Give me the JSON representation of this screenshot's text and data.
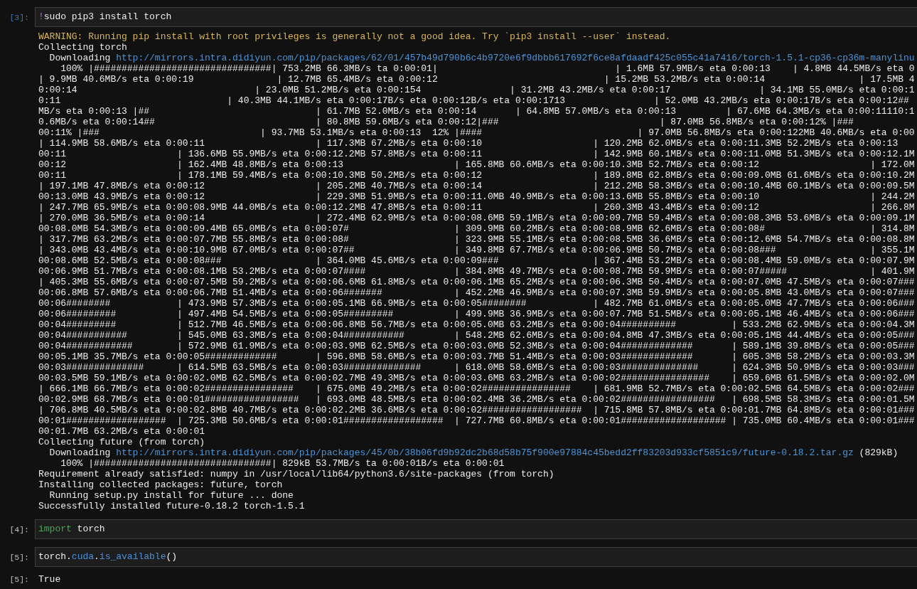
{
  "cells": [
    {
      "prompt": "[3]:",
      "selected": true,
      "source": [
        {
          "kind": "magic",
          "text": "!"
        },
        {
          "kind": "name",
          "text": "sudo pip3 install torch"
        }
      ],
      "output": {
        "kind": "stream",
        "lines": [
          {
            "kind": "warning",
            "text": "WARNING: Running pip install with root privileges is generally not a good idea. Try `pip3 install --user` instead."
          },
          {
            "kind": "text",
            "text": "Collecting torch"
          },
          {
            "kind": "download",
            "label": "  Downloading",
            "url": "http://mirrors.intra.didiyun.com/pip/packages/62/01/457b49d790b6c4b9720e6f9dbbb617692f6ce8afdaadf425c055c41a7416/torch-1.5.1-cp36-cp36m-manylinu"
          },
          {
            "kind": "text",
            "text": "    100% |################################| 753.2MB 66.3MB/s ta 0:00:01|                                | 1.6MB 57.9MB/s eta 0:00:13    | 4.8MB 44.5MB/s eta 0"
          },
          {
            "kind": "text",
            "text": "| 9.9MB 40.6MB/s eta 0:00:19               | 12.7MB 65.4MB/s eta 0:00:12                              | 15.2MB 53.2MB/s eta 0:00:14                 | 17.5MB 4"
          },
          {
            "kind": "text",
            "text": "0:00:14                                | 23.0MB 51.2MB/s eta 0:00:154                | 31.2MB 43.2MB/s eta 0:00:17                | 34.1MB 55.0MB/s eta 0:00:1"
          },
          {
            "kind": "text",
            "text": "0:11                              | 40.3MB 44.1MB/s eta 0:00:17B/s eta 0:00:12B/s eta 0:00:1713                | 52.0MB 43.2MB/s eta 0:00:17B/s eta 0:00:12##"
          },
          {
            "kind": "text",
            "text": "MB/s eta 0:00:13 |##                              | 61.7MB 52.0MB/s eta 0:00:14       | 64.8MB 57.0MB/s eta 0:00:13         | 67.6MB 64.3MB/s eta 0:00:11110:1"
          },
          {
            "kind": "text",
            "text": "0.6MB/s eta 0:00:14##                             | 80.8MB 59.6MB/s eta 0:00:12|###                             | 87.0MB 56.8MB/s eta 0:00:12% |###"
          },
          {
            "kind": "text",
            "text": "00:11% |###                             | 93.7MB 53.1MB/s eta 0:00:13  12% |####                            | 97.0MB 56.8MB/s eta 0:00:122MB 40.6MB/s eta 0:00"
          },
          {
            "kind": "text",
            "text": "| 114.9MB 58.6MB/s eta 0:00:11                    | 117.3MB 67.2MB/s eta 0:00:10                    | 120.2MB 62.0MB/s eta 0:00:11.3MB 52.2MB/s eta 0:00:13"
          },
          {
            "kind": "text",
            "text": "00:11                    | 136.6MB 55.9MB/s eta 0:00:12.2MB 57.8MB/s eta 0:00:11                    | 142.9MB 60.1MB/s eta 0:00:11.0MB 51.3MB/s eta 0:00:12.1M"
          },
          {
            "kind": "text",
            "text": "00:12                    | 162.4MB 48.8MB/s eta 0:00:13                    | 165.8MB 60.6MB/s eta 0:00:10.3MB 52.7MB/s eta 0:00:12                    | 172.0M"
          },
          {
            "kind": "text",
            "text": "00:11                    | 178.1MB 59.4MB/s eta 0:00:10.3MB 50.2MB/s eta 0:00:12                    | 189.8MB 62.8MB/s eta 0:00:09.0MB 61.6MB/s eta 0:00:10.2M"
          },
          {
            "kind": "text",
            "text": "| 197.1MB 47.8MB/s eta 0:00:12                    | 205.2MB 40.7MB/s eta 0:00:14                    | 212.2MB 58.3MB/s eta 0:00:10.4MB 60.1MB/s eta 0:00:09.5M"
          },
          {
            "kind": "text",
            "text": "00:13.0MB 43.9MB/s eta 0:00:12                    | 229.3MB 51.9MB/s eta 0:00:11.0MB 40.9MB/s eta 0:00:13.6MB 55.8MB/s eta 0:00:10                    | 244.2M"
          },
          {
            "kind": "text",
            "text": "| 247.7MB 65.9MB/s eta 0:00:08.9MB 44.0MB/s eta 0:00:12.2MB 47.8MB/s eta 0:00:11                    | 260.3MB 43.4MB/s eta 0:00:12                    | 266.8M"
          },
          {
            "kind": "text",
            "text": "| 270.0MB 36.5MB/s eta 0:00:14                    | 272.4MB 62.9MB/s eta 0:00:08.6MB 59.1MB/s eta 0:00:09.7MB 59.4MB/s eta 0:00:08.3MB 53.6MB/s eta 0:00:09.1M"
          },
          {
            "kind": "text",
            "text": "00:08.0MB 54.3MB/s eta 0:00:09.4MB 65.0MB/s eta 0:00:07#                   | 309.9MB 60.2MB/s eta 0:00:08.9MB 62.6MB/s eta 0:00:08#                   | 314.8M"
          },
          {
            "kind": "text",
            "text": "| 317.7MB 63.2MB/s eta 0:00:07.7MB 55.8MB/s eta 0:00:08#                   | 323.9MB 55.1MB/s eta 0:00:08.5MB 36.6MB/s eta 0:00:12.6MB 54.7MB/s eta 0:00:08.8M"
          },
          {
            "kind": "text",
            "text": "| 343.0MB 43.4MB/s eta 0:00:10.9MB 67.0MB/s eta 0:00:07##                  | 349.8MB 67.7MB/s eta 0:00:06.9MB 50.7MB/s eta 0:00:08###                 | 355.1M"
          },
          {
            "kind": "text",
            "text": "00:08.6MB 52.5MB/s eta 0:00:08###                 | 364.0MB 45.6MB/s eta 0:00:09###                 | 367.4MB 53.2MB/s eta 0:00:08.4MB 59.0MB/s eta 0:00:07.9M"
          },
          {
            "kind": "text",
            "text": "00:06.9MB 51.7MB/s eta 0:00:08.1MB 53.2MB/s eta 0:00:07####                | 384.8MB 49.7MB/s eta 0:00:08.7MB 59.9MB/s eta 0:00:07#####               | 401.9M"
          },
          {
            "kind": "text",
            "text": "| 405.3MB 55.6MB/s eta 0:00:07.5MB 59.2MB/s eta 0:00:06.6MB 61.8MB/s eta 0:00:06.1MB 65.2MB/s eta 0:00:06.3MB 50.4MB/s eta 0:00:07.0MB 47.5MB/s eta 0:00:07###"
          },
          {
            "kind": "text",
            "text": "00:06.8MB 57.6MB/s eta 0:00:06.7MB 51.4MB/s eta 0:00:06#######             | 452.2MB 46.9MB/s eta 0:00:07.3MB 59.9MB/s eta 0:00:05.8MB 43.0MB/s eta 0:00:07###"
          },
          {
            "kind": "text",
            "text": "00:06########            | 473.9MB 57.3MB/s eta 0:00:05.1MB 66.9MB/s eta 0:00:05########            | 482.7MB 61.0MB/s eta 0:00:05.0MB 47.7MB/s eta 0:00:06###"
          },
          {
            "kind": "text",
            "text": "00:06#########           | 497.4MB 54.5MB/s eta 0:00:05#########           | 499.9MB 36.9MB/s eta 0:00:07.7MB 51.5MB/s eta 0:00:05.1MB 46.4MB/s eta 0:00:06###"
          },
          {
            "kind": "text",
            "text": "00:04#########           | 512.7MB 46.5MB/s eta 0:00:06.8MB 56.7MB/s eta 0:00:05.0MB 63.2MB/s eta 0:00:04##########          | 533.2MB 62.9MB/s eta 0:00:04.3M"
          },
          {
            "kind": "text",
            "text": "00:04###########         | 545.0MB 63.3MB/s eta 0:00:04###########         | 548.2MB 62.6MB/s eta 0:00:04.8MB 47.3MB/s eta 0:00:05.1MB 44.4MB/s eta 0:00:05###"
          },
          {
            "kind": "text",
            "text": "00:04############        | 572.9MB 61.9MB/s eta 0:00:03.9MB 62.5MB/s eta 0:00:03.0MB 52.3MB/s eta 0:00:04#############       | 589.1MB 39.8MB/s eta 0:00:05###"
          },
          {
            "kind": "text",
            "text": "00:05.1MB 35.7MB/s eta 0:00:05#############       | 596.8MB 58.6MB/s eta 0:00:03.7MB 51.4MB/s eta 0:00:03#############       | 605.3MB 58.2MB/s eta 0:00:03.3M"
          },
          {
            "kind": "text",
            "text": "00:03##############      | 614.5MB 63.5MB/s eta 0:00:03##############      | 618.0MB 58.6MB/s eta 0:00:03##############      | 624.3MB 50.9MB/s eta 0:00:03###"
          },
          {
            "kind": "text",
            "text": "00:03.5MB 59.1MB/s eta 0:00:02.0MB 62.5MB/s eta 0:00:02.7MB 49.3MB/s eta 0:00:03.6MB 63.2MB/s eta 0:00:02################    | 659.6MB 61.5MB/s eta 0:00:02.0M"
          },
          {
            "kind": "text",
            "text": "| 666.1MB 66.7MB/s eta 0:00:02################    | 675.0MB 49.2MB/s eta 0:00:02################    | 681.9MB 52.7MB/s eta 0:00:02.5MB 64.5MB/s eta 0:00:02###"
          },
          {
            "kind": "text",
            "text": "00:02.9MB 68.7MB/s eta 0:00:01#################   | 693.0MB 48.5MB/s eta 0:00:02.4MB 36.2MB/s eta 0:00:02#################   | 698.5MB 58.3MB/s eta 0:00:01.5M"
          },
          {
            "kind": "text",
            "text": "| 706.8MB 40.5MB/s eta 0:00:02.8MB 40.7MB/s eta 0:00:02.2MB 36.6MB/s eta 0:00:02##################  | 715.8MB 57.8MB/s eta 0:00:01.7MB 64.8MB/s eta 0:00:01###"
          },
          {
            "kind": "text",
            "text": "00:01##################  | 725.3MB 50.6MB/s eta 0:00:01##################  | 727.7MB 60.8MB/s eta 0:00:01################### | 735.0MB 60.4MB/s eta 0:00:01###"
          },
          {
            "kind": "text",
            "text": "00:01.7MB 63.2MB/s eta 0:00:01"
          },
          {
            "kind": "text",
            "text": "Collecting future (from torch)"
          },
          {
            "kind": "download",
            "label": "  Downloading",
            "url": "http://mirrors.intra.didiyun.com/pip/packages/45/0b/38b06fd9b92dc2b68d58b75f900e97884c45bedd2ff83203d933cf5851c9/future-0.18.2.tar.gz",
            "suffix": "(829kB)"
          },
          {
            "kind": "text",
            "text": "    100% |################################| 829kB 53.7MB/s ta 0:00:01B/s eta 0:00:01"
          },
          {
            "kind": "text",
            "text": "Requirement already satisfied: numpy in /usr/local/lib64/python3.6/site-packages (from torch)"
          },
          {
            "kind": "text",
            "text": "Installing collected packages: future, torch"
          },
          {
            "kind": "text",
            "text": "  Running setup.py install for future ... done"
          },
          {
            "kind": "text",
            "text": "Successfully installed future-0.18.2 torch-1.5.1"
          }
        ]
      }
    },
    {
      "prompt": "[4]:",
      "selected": false,
      "source": [
        {
          "kind": "keyword",
          "text": "import"
        },
        {
          "kind": "name",
          "text": " torch"
        }
      ]
    },
    {
      "prompt": "[5]:",
      "selected": false,
      "source": [
        {
          "kind": "name",
          "text": "torch"
        },
        {
          "kind": "punct",
          "text": "."
        },
        {
          "kind": "attr",
          "text": "cuda"
        },
        {
          "kind": "punct",
          "text": "."
        },
        {
          "kind": "attr",
          "text": "is_available"
        },
        {
          "kind": "punct",
          "text": "()"
        }
      ],
      "output": {
        "kind": "result",
        "prompt": "[5]:",
        "text": "True"
      }
    }
  ]
}
